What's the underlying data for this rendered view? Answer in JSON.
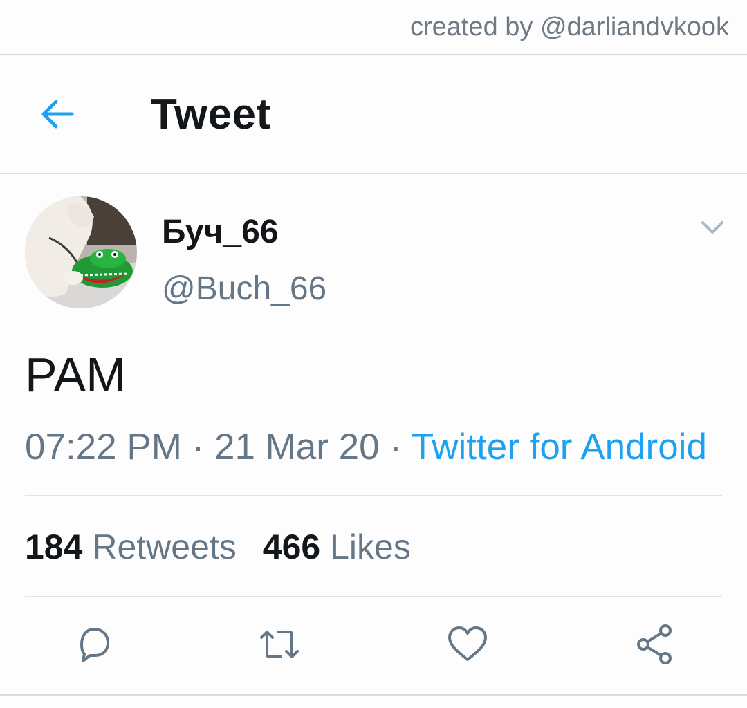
{
  "watermark": "created by @darliandvkook",
  "header": {
    "title": "Tweet",
    "back_icon": "arrow-left-icon"
  },
  "tweet": {
    "display_name": "Буч_66",
    "handle": "@Buch_66",
    "avatar": "avatar-dog-with-crocodile-toy",
    "menu_icon": "chevron-down-icon",
    "text": "PAM",
    "time": "07:22 PM",
    "date": "21 Mar 20",
    "separator": "·",
    "source": "Twitter for Android",
    "retweets": {
      "count": "184",
      "label": "Retweets"
    },
    "likes": {
      "count": "466",
      "label": "Likes"
    }
  },
  "actions": [
    {
      "icon": "reply-icon"
    },
    {
      "icon": "retweet-icon"
    },
    {
      "icon": "like-icon"
    },
    {
      "icon": "share-icon"
    }
  ],
  "colors": {
    "accent": "#1da1f2",
    "secondary_text": "#657786",
    "primary_text": "#14171a",
    "divider": "#dfe4e8"
  }
}
